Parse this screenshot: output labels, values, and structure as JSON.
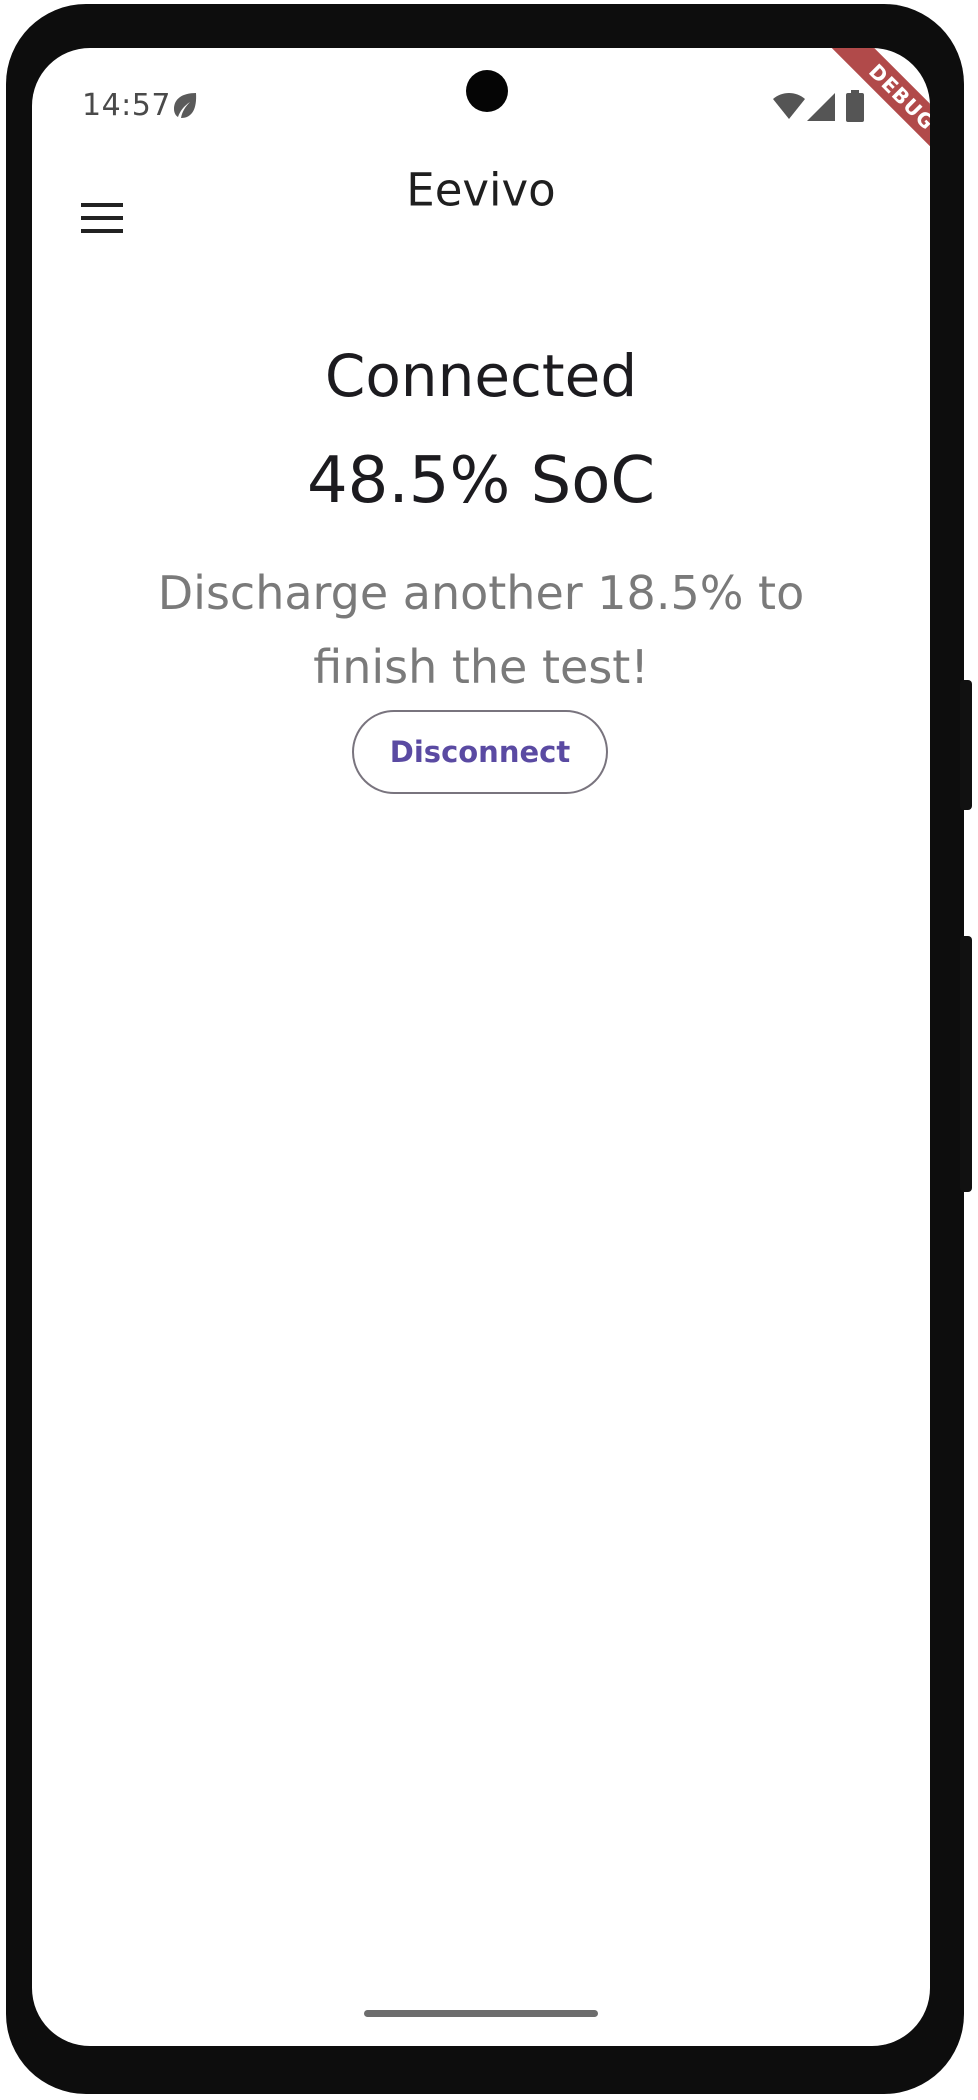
{
  "status_bar": {
    "time": "14:57",
    "icons": [
      "leaf-icon",
      "wifi-icon",
      "signal-icon",
      "battery-icon"
    ],
    "debug_banner": "DEBUG"
  },
  "app_bar": {
    "title": "Eevivo",
    "menu_icon": "menu-icon"
  },
  "main": {
    "connection_status": "Connected",
    "soc": "48.5% SoC",
    "hint": "Discharge another 18.5% to finish the test!",
    "disconnect_label": "Disconnect"
  },
  "colors": {
    "accent": "#5a4aa2",
    "debug_banner": "#b14a4a",
    "outline": "#79747e"
  }
}
